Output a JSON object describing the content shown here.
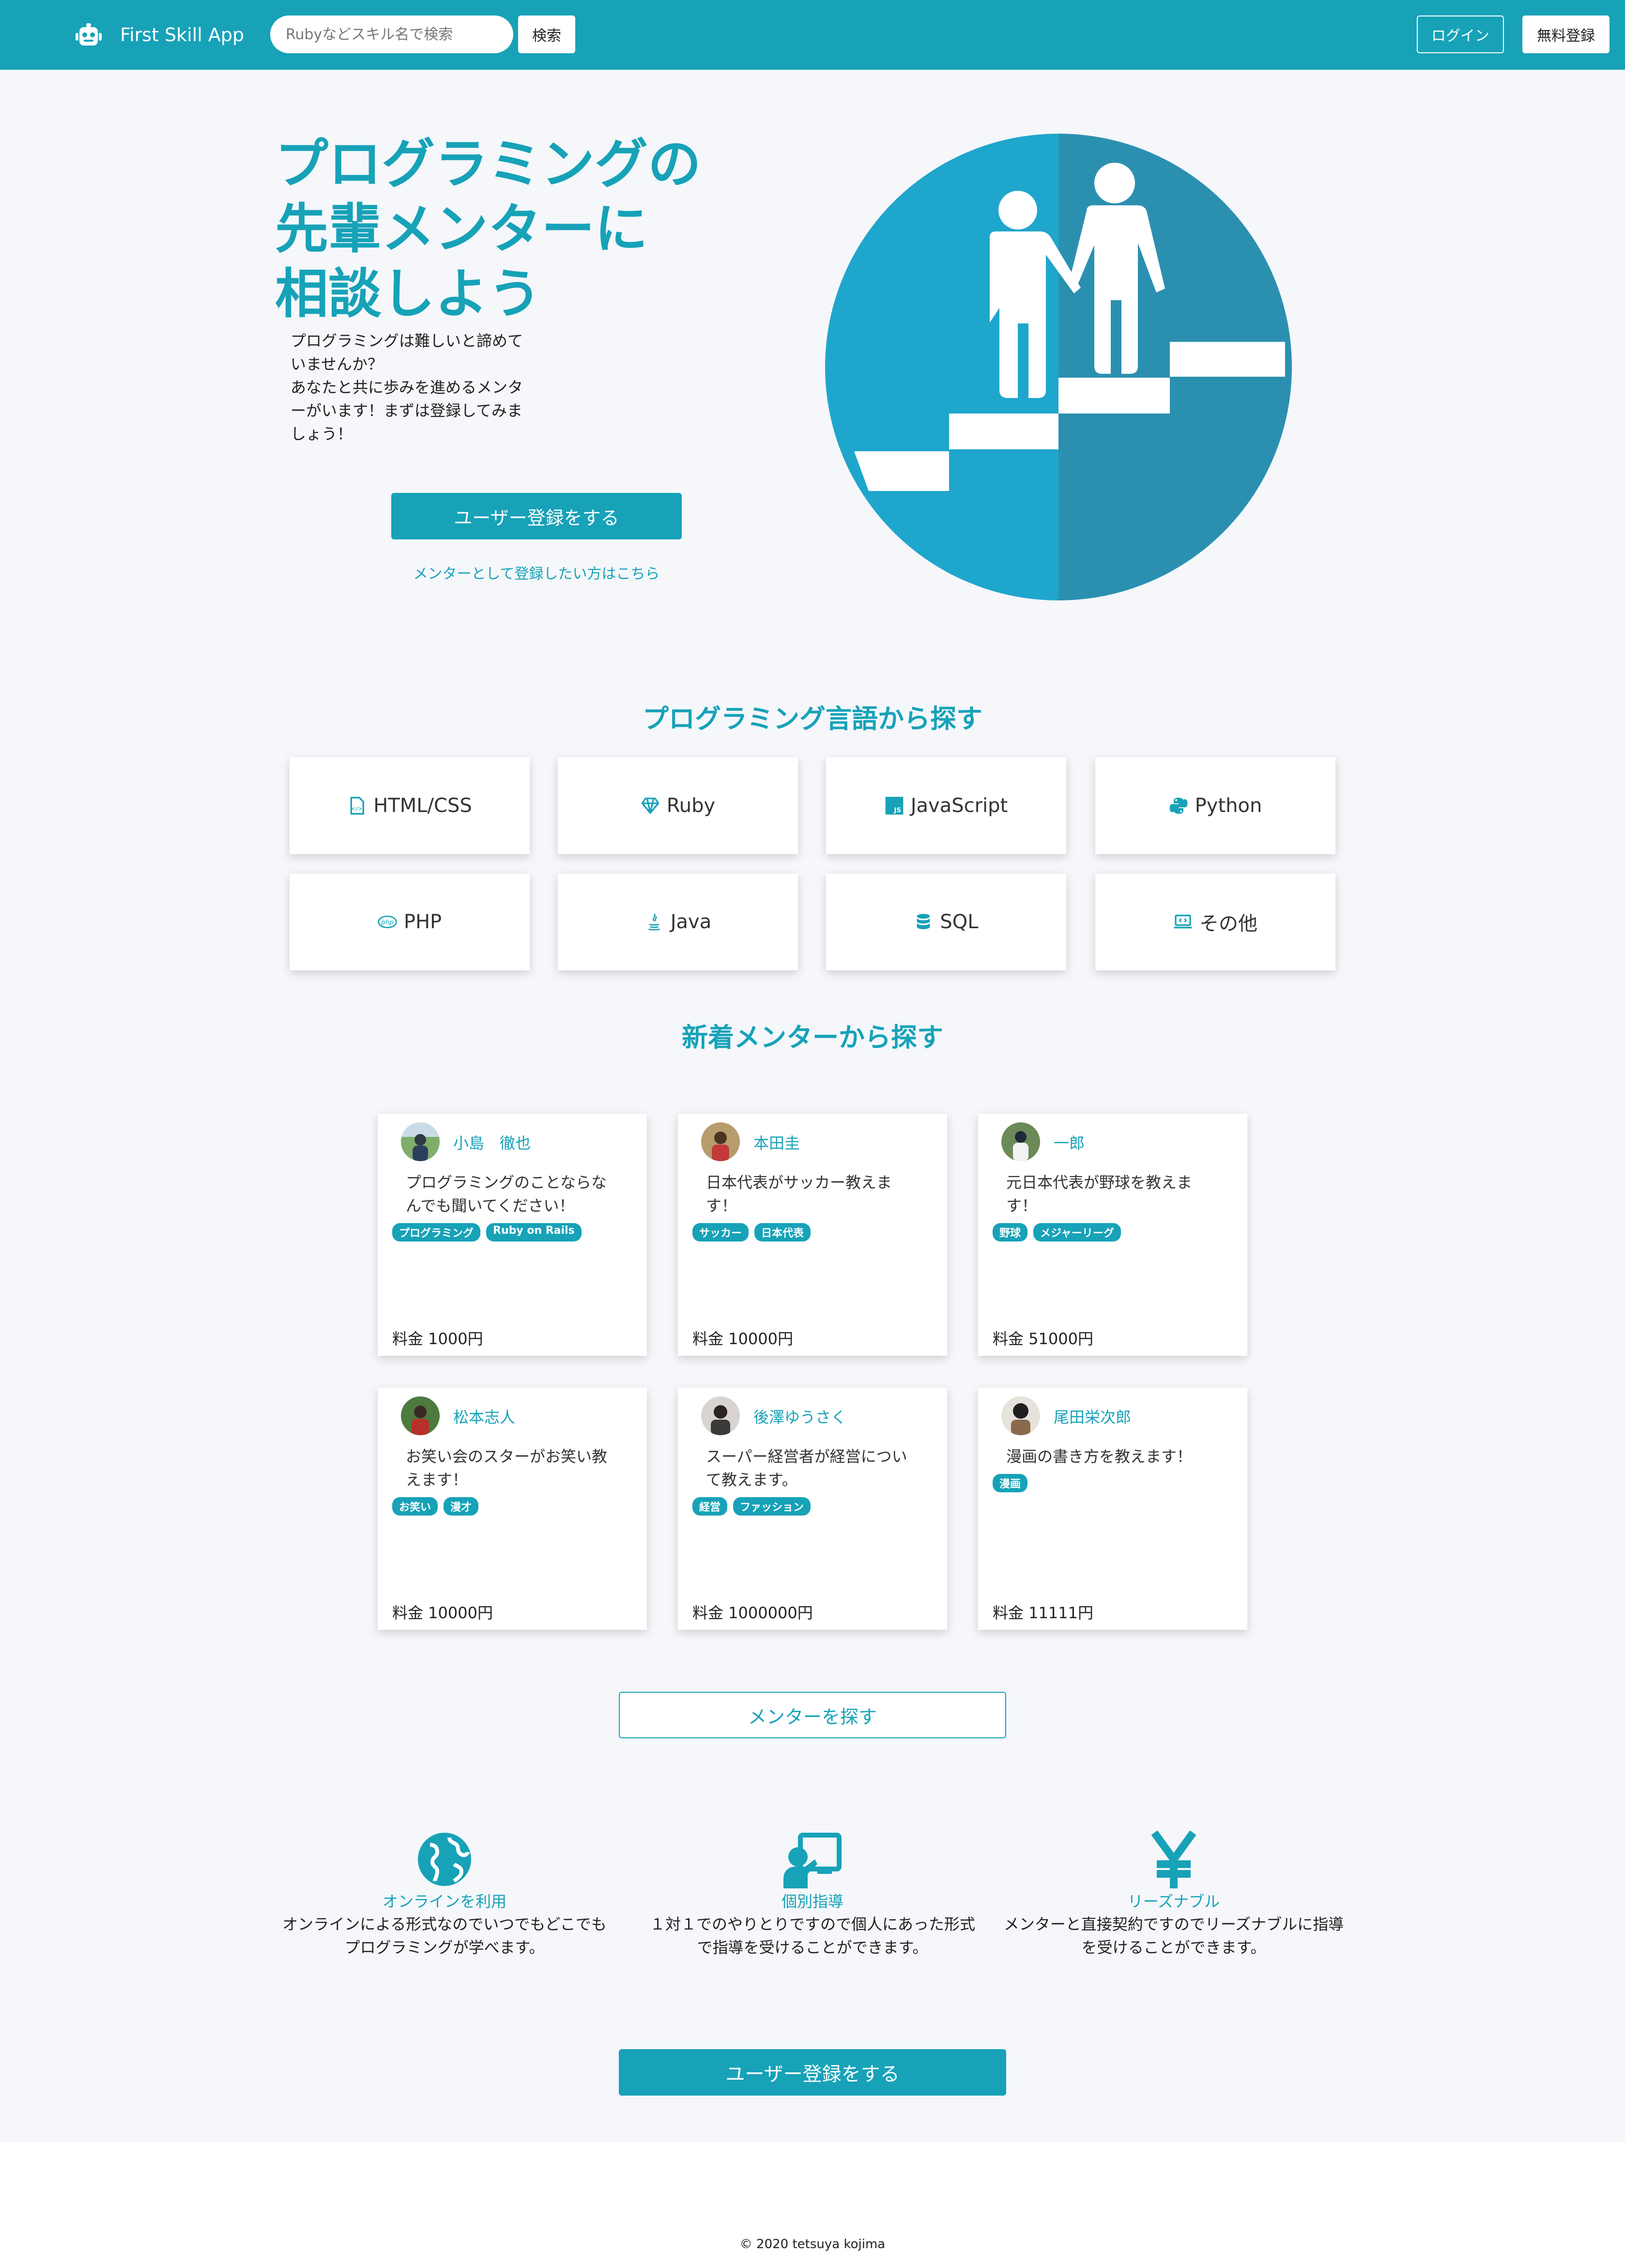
{
  "colors": {
    "accent": "#17a2b8",
    "background": "#f5f7fa",
    "illustration_light": "#1fa6cc",
    "illustration_dark": "#2b90b0"
  },
  "navbar": {
    "brand_icon": "robot-icon",
    "brand": "First Skill App",
    "search_placeholder": "Rubyなどスキル名で検索",
    "search_button": "検索",
    "login": "ログイン",
    "signup": "無料登録"
  },
  "hero": {
    "title_lines": [
      "プログラミングの",
      "先輩メンターに",
      "相談しよう"
    ],
    "description_lines": [
      "プログラミングは難しいと諦めて",
      "いませんか？",
      "あなたと共に歩みを進めるメンタ",
      "ーがいます！まずは登録してみま",
      "しょう！"
    ],
    "register_button": "ユーザー登録をする",
    "mentor_link": "メンターとして登録したい方はこちら",
    "illustration": "mentor-stairs-illustration"
  },
  "languages": {
    "title": "プログラミング言語から探す",
    "items": [
      {
        "label": "HTML/CSS",
        "icon": "html-file-icon"
      },
      {
        "label": "Ruby",
        "icon": "gem-icon"
      },
      {
        "label": "JavaScript",
        "icon": "js-icon"
      },
      {
        "label": "Python",
        "icon": "python-icon"
      },
      {
        "label": "PHP",
        "icon": "php-icon"
      },
      {
        "label": "Java",
        "icon": "java-icon"
      },
      {
        "label": "SQL",
        "icon": "database-icon"
      },
      {
        "label": "その他",
        "icon": "code-laptop-icon"
      }
    ]
  },
  "mentors": {
    "title": "新着メンターから探す",
    "items": [
      {
        "name": "小島　徹也",
        "intro_lines": [
          "プログラミングのことならな",
          "んでも聞いてください！"
        ],
        "tags": [
          "プログラミング",
          "Ruby on Rails"
        ],
        "price": "料金 1000円"
      },
      {
        "name": "本田圭",
        "intro_lines": [
          "日本代表がサッカー教えま",
          "す！"
        ],
        "tags": [
          "サッカー",
          "日本代表"
        ],
        "price": "料金 10000円"
      },
      {
        "name": "一郎",
        "intro_lines": [
          "元日本代表が野球を教えま",
          "す！"
        ],
        "tags": [
          "野球",
          "メジャーリーグ"
        ],
        "price": "料金 51000円"
      },
      {
        "name": "松本志人",
        "intro_lines": [
          "お笑い会のスターがお笑い教",
          "えます！"
        ],
        "tags": [
          "お笑い",
          "漫才"
        ],
        "price": "料金 10000円"
      },
      {
        "name": "後澤ゆうさく",
        "intro_lines": [
          "スーパー経営者が経営につい",
          "て教えます。"
        ],
        "tags": [
          "経営",
          "ファッション"
        ],
        "price": "料金 1000000円"
      },
      {
        "name": "尾田栄次郎",
        "intro_lines": [
          "漫画の書き方を教えます！"
        ],
        "tags": [
          "漫画"
        ],
        "price": "料金 11111円"
      }
    ],
    "find_button": "メンターを探す"
  },
  "features": [
    {
      "icon": "globe-icon",
      "title": "オンラインを利用",
      "desc_lines": [
        "オンラインによる形式なのでいつでもどこでも",
        "プログラミングが学べます。"
      ]
    },
    {
      "icon": "teacher-icon",
      "title": "個別指導",
      "desc_lines": [
        "１対１でのやりとりですので個人にあった形式",
        "で指導を受けることができます。"
      ]
    },
    {
      "icon": "yen-icon",
      "title": "リーズナブル",
      "desc_lines": [
        "メンターと直接契約ですのでリーズナブルに指導",
        "を受けることができます。"
      ]
    }
  ],
  "bottom_cta": {
    "register_button": "ユーザー登録をする"
  },
  "footer": {
    "text": "© 2020 tetsuya kojima"
  }
}
